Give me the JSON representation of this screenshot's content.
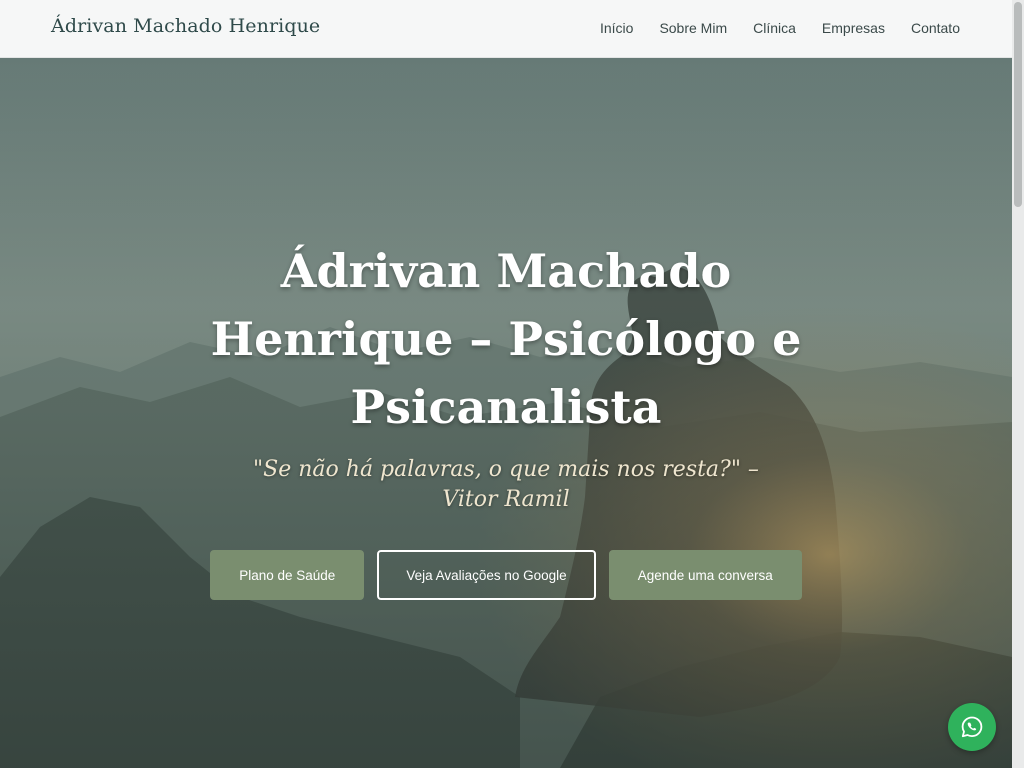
{
  "header": {
    "brand": "Ádrivan Machado Henrique",
    "nav": [
      {
        "label": "Início"
      },
      {
        "label": "Sobre Mim"
      },
      {
        "label": "Clínica"
      },
      {
        "label": "Empresas"
      },
      {
        "label": "Contato"
      }
    ]
  },
  "hero": {
    "title": "Ádrivan Machado Henrique – Psicólogo e Psicanalista",
    "quote": "\"Se não há palavras, o que mais nos resta?\" – Vitor Ramil",
    "buttons": [
      {
        "label": "Plano de Saúde",
        "style": "filled"
      },
      {
        "label": "Veja Avaliações no Google",
        "style": "outline"
      },
      {
        "label": "Agende uma conversa",
        "style": "filled"
      }
    ]
  },
  "floating": {
    "whatsapp_icon": "whatsapp-icon"
  },
  "colors": {
    "button_green": "#7a8e6f",
    "whatsapp_green": "#2fb25c",
    "brand_text": "#2f4a4a",
    "quote_text": "#efe6cf"
  }
}
